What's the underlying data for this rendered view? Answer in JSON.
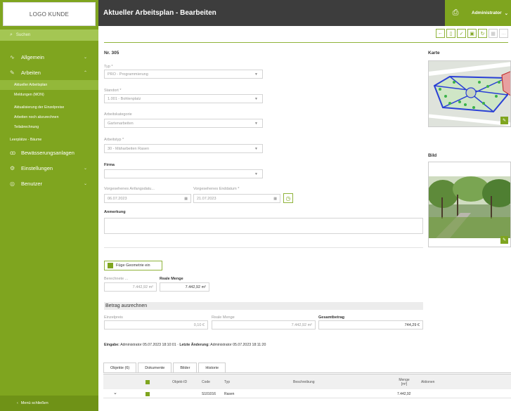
{
  "sidebar": {
    "logo": "LOGO KUNDE",
    "search": "Suchen",
    "items": [
      {
        "label": "Allgemein",
        "icon": "activity-icon"
      },
      {
        "label": "Arbeiten",
        "icon": "tools-icon"
      },
      {
        "label": "Bewässerungsanlagen",
        "icon": "water-icon"
      },
      {
        "label": "Einstellungen",
        "icon": "gear-icon"
      },
      {
        "label": "Benutzer",
        "icon": "user-icon"
      }
    ],
    "subitems": [
      "Aktueller Arbeitsplan",
      "Meldungen (MON)",
      "Aktualisierung der Einzelpreise",
      "Arbeiten noch abzurechnen",
      "Teilabrechnung",
      "Leerplätze - Bäume"
    ],
    "close": "Menü schließen"
  },
  "header": {
    "title": "Aktueller Arbeitsplan - Bearbeiten",
    "user": "Administrator"
  },
  "form": {
    "nr": "Nr. 305",
    "typ_label": "Typ *",
    "typ_value": "PRO - Programmierung",
    "standort_label": "Standort *",
    "standort_value": "1.001 - Bohlenplatz",
    "kategorie_label": "Arbeitskategorie",
    "kategorie_value": "Gartenarbeiten",
    "arbeitstyp_label": "Arbeitstyp *",
    "arbeitstyp_value": "30 - Mäharbeiten Rasen",
    "firma_label": "Firma",
    "firma_value": "",
    "anfang_label": "Vorgesehenes Anfangsdatu...",
    "anfang_value": "06.07.2023",
    "ende_label": "Vorgesehenes Enddatum *",
    "ende_value": "21.07.2023",
    "anmerkung_label": "Anmerkung"
  },
  "right": {
    "karte": "Karte",
    "bild": "Bild"
  },
  "geometry": {
    "button": "Füge Geometrie ein",
    "berechnete_label": "Berechnete ...",
    "berechnete_value": "7.442,92 m²",
    "reale_label": "Reale Menge",
    "reale_value": "7.442,92 m²"
  },
  "betrag": {
    "title": "Betrag ausrechnen",
    "einzelpreis_label": "Einzelpreis",
    "einzelpreis_value": "0,10 €",
    "reale_label": "Reale Menge",
    "reale_value": "7.442,92 m²",
    "gesamt_label": "Gesamtbetrag",
    "gesamt_value": "744,29 €"
  },
  "info": {
    "eingabe_label": "Eingabe:",
    "eingabe_value": "Administrator 05.07.2023 18:10:01",
    "sep": "·",
    "aenderung_label": "Letzte Änderung:",
    "aenderung_value": "Administrator 05.07.2023 18:11:20"
  },
  "tabs": [
    "Objekte (6)",
    "Dokumente",
    "Bilder",
    "Historie"
  ],
  "table": {
    "headers": [
      "Objekt-ID",
      "Code",
      "Typ",
      "Beschreibung",
      "Menge [m²]",
      "Aktionen"
    ],
    "rows": [
      {
        "id": "",
        "code": "S101016",
        "typ": "Rasen",
        "beschreibung": "",
        "menge": "7.442,92"
      }
    ]
  },
  "colors": {
    "accent": "#7fa51f",
    "topbar": "#3d3d3d"
  }
}
